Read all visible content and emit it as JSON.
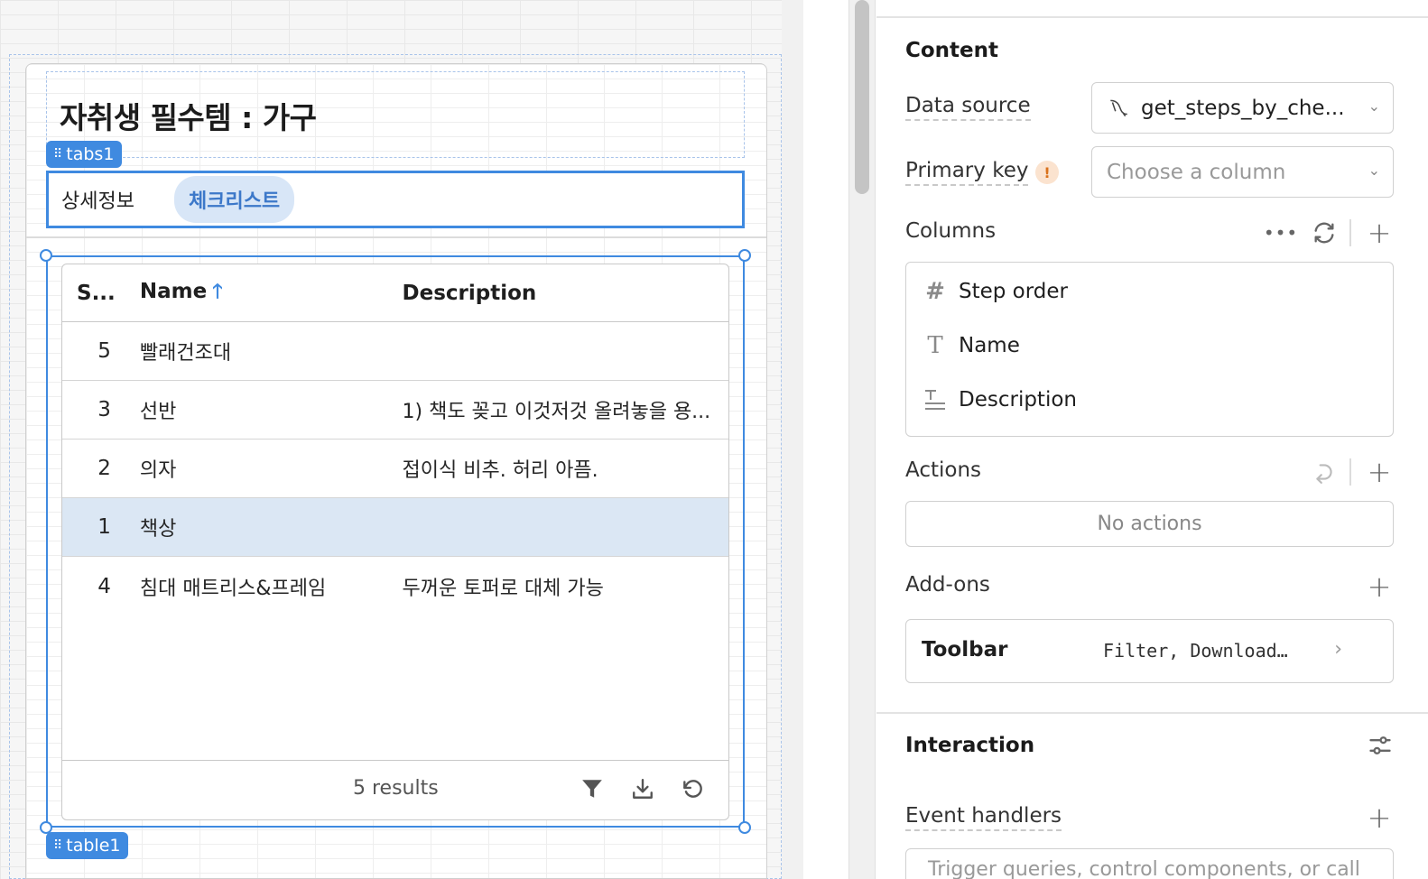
{
  "canvas": {
    "page_title": "자취생 필수템 : 가구",
    "tabs_tag": "tabs1",
    "table_tag": "table1",
    "tabs": [
      {
        "label": "상세정보",
        "active": false
      },
      {
        "label": "체크리스트",
        "active": true
      }
    ]
  },
  "table": {
    "headers": [
      "S...",
      "Name",
      "Description"
    ],
    "sort_column": "Name",
    "sort_icon": "arrow-up-icon",
    "rows": [
      {
        "step": "5",
        "name": "빨래건조대",
        "description": "",
        "selected": false
      },
      {
        "step": "3",
        "name": "선반",
        "description": "1) 책도 꽂고 이것저것 올려놓을 용...",
        "selected": false
      },
      {
        "step": "2",
        "name": "의자",
        "description": "접이식 비추. 허리 아픔.",
        "selected": false
      },
      {
        "step": "1",
        "name": "책상",
        "description": "",
        "selected": true
      },
      {
        "step": "4",
        "name": "침대 매트리스&프레임",
        "description": "두꺼운 토퍼로 대체 가능",
        "selected": false
      }
    ],
    "footer": {
      "results": "5 results",
      "icons": [
        "filter-icon",
        "download-icon",
        "refresh-icon"
      ]
    }
  },
  "inspector": {
    "content_title": "Content",
    "data_source_label": "Data source",
    "data_source_value": "get_steps_by_che...",
    "primary_key_label": "Primary key",
    "primary_key_warning": "!",
    "primary_key_placeholder": "Choose a column",
    "columns_label": "Columns",
    "columns": [
      {
        "icon": "number-icon",
        "label": "Step order"
      },
      {
        "icon": "text-icon",
        "label": "Name"
      },
      {
        "icon": "multiline-text-icon",
        "label": "Description"
      }
    ],
    "actions_label": "Actions",
    "no_actions": "No actions",
    "addons_label": "Add-ons",
    "toolbar_label": "Toolbar",
    "toolbar_value": "Filter, Download…",
    "interaction_title": "Interaction",
    "event_handlers_label": "Event handlers",
    "event_handlers_hint": "Trigger queries, control components, or call"
  },
  "colors": {
    "accent": "#3f8ae0",
    "selected_row": "#dbe7f4",
    "active_tab_bg": "#d8e6f7"
  }
}
